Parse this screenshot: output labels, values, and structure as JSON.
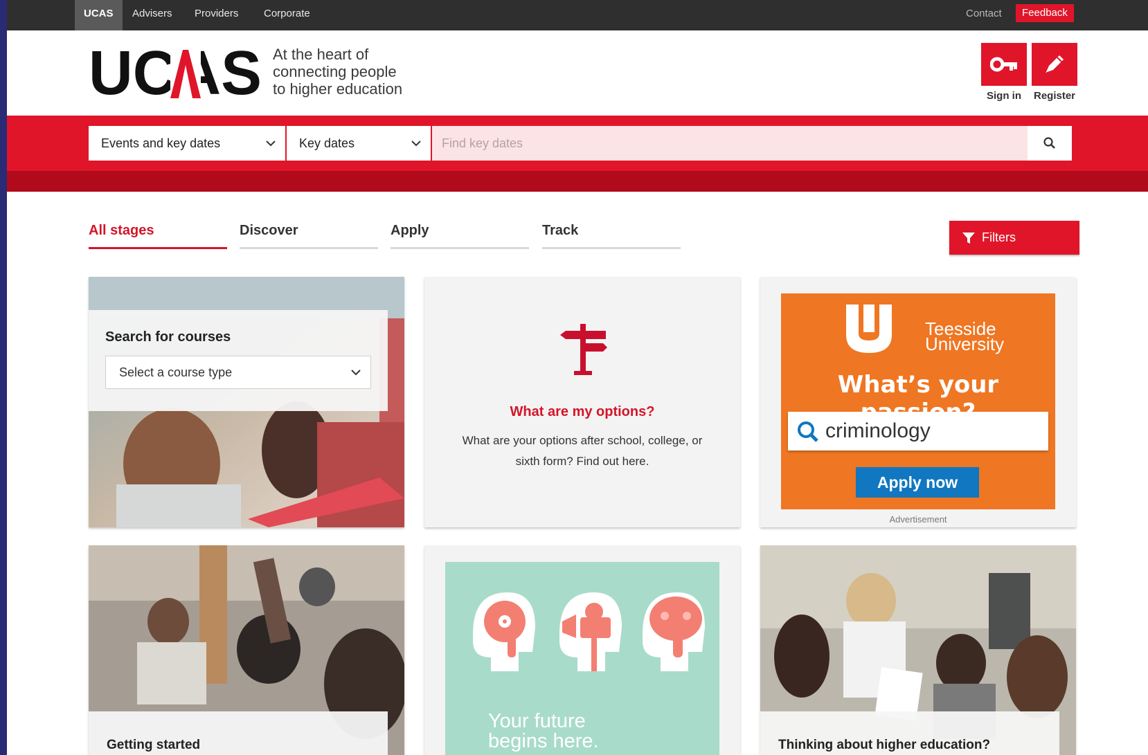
{
  "topbar": {
    "links": [
      "UCAS",
      "Advisers",
      "Providers",
      "Corporate"
    ],
    "contact": "Contact",
    "feedback": "Feedback"
  },
  "header": {
    "logo_text": "UCAS",
    "tagline": [
      "At the heart of",
      "connecting people",
      "to higher education"
    ],
    "sign_in": "Sign in",
    "register": "Register"
  },
  "search": {
    "category": "Events and key dates",
    "subcategory": "Key dates",
    "placeholder": "Find key dates"
  },
  "tabs": [
    "All stages",
    "Discover",
    "Apply",
    "Track"
  ],
  "filters_label": "Filters",
  "cards": {
    "search_courses": {
      "title": "Search for courses",
      "select_value": "Select a course type"
    },
    "options": {
      "title": "What are my options?",
      "text": "What are your options after school, college, or sixth form? Find out here."
    },
    "ad": {
      "university": [
        "Teesside",
        "University"
      ],
      "question": "What’s your passion?",
      "search_text": "criminology",
      "cta": "Apply now",
      "label": "Advertisement"
    },
    "getting_started": {
      "title": "Getting started"
    },
    "future": {
      "text": [
        "Your future",
        "begins here."
      ]
    },
    "thinking": {
      "title": "Thinking about higher education?"
    }
  },
  "colors": {
    "brand_red": "#e0152a",
    "dark_red": "#b00a1b",
    "topbar": "#2f2f2f",
    "ad_orange": "#ef7622",
    "ad_blue": "#1077c0",
    "teal": "#a9dbca"
  },
  "icons": {
    "sign_in": "key-icon",
    "register": "pencil-icon",
    "search": "search-icon",
    "filters": "funnel-icon",
    "options": "signpost-icon"
  }
}
